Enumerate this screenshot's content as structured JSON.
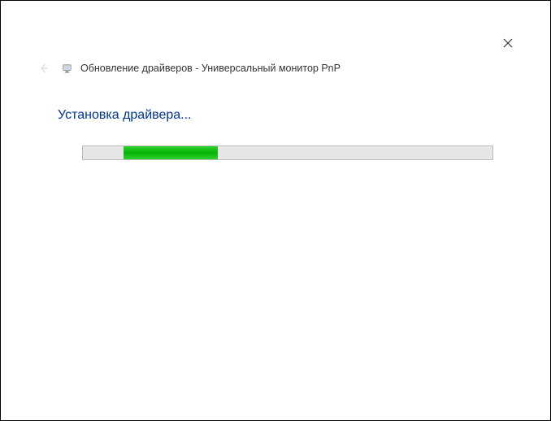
{
  "header": {
    "title": "Обновление драйверов - Универсальный монитор PnP"
  },
  "content": {
    "status": "Установка драйвера..."
  },
  "progress": {
    "offset_percent": 10,
    "width_percent": 23
  }
}
